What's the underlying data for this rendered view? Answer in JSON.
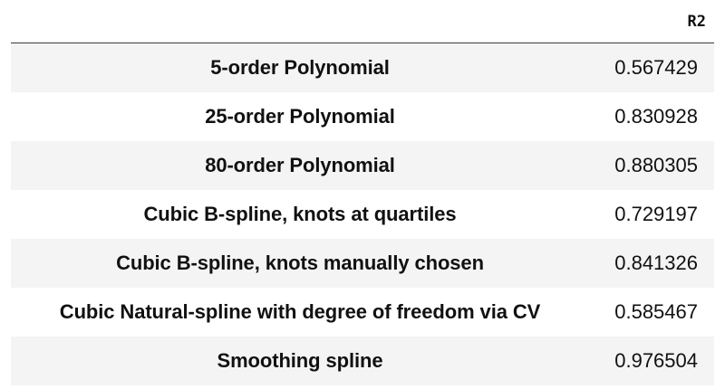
{
  "table": {
    "columns": [
      "R2"
    ],
    "rows": [
      {
        "label": "5-order Polynomial",
        "r2": "0.567429"
      },
      {
        "label": "25-order Polynomial",
        "r2": "0.830928"
      },
      {
        "label": "80-order Polynomial",
        "r2": "0.880305"
      },
      {
        "label": "Cubic B-spline, knots at quartiles",
        "r2": "0.729197"
      },
      {
        "label": "Cubic B-spline, knots manually chosen",
        "r2": "0.841326"
      },
      {
        "label": "Cubic Natural-spline with degree of freedom via CV",
        "r2": "0.585467"
      },
      {
        "label": "Smoothing spline",
        "r2": "0.976504"
      }
    ]
  }
}
